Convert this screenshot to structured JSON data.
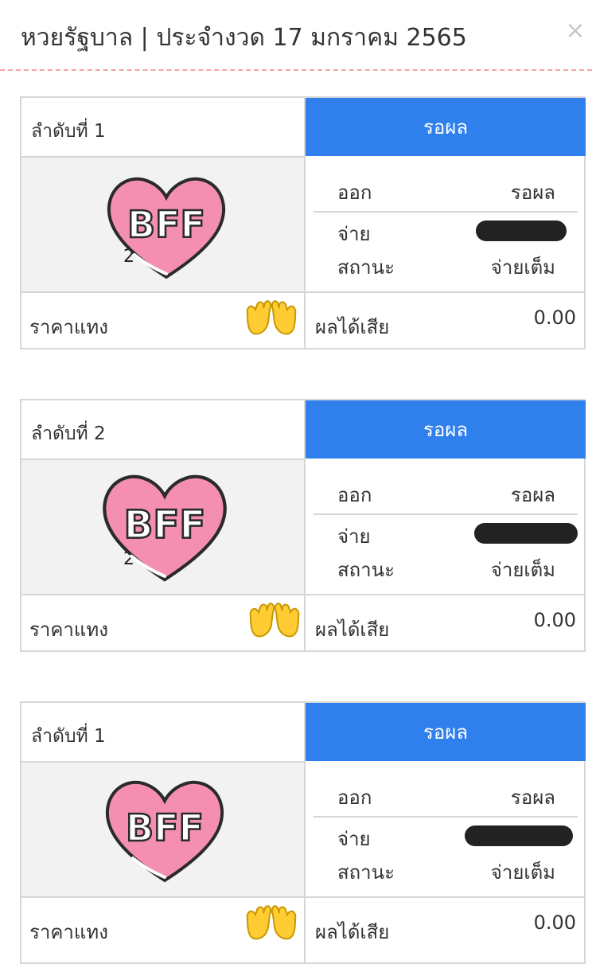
{
  "header": {
    "title": "หวยรัฐบาล | ประจำงวด 17 มกราคม 2565",
    "close_icon": "×"
  },
  "colors": {
    "status_bar": "#2f80ed",
    "divider": "#f4a59b",
    "heart_fill": "#f48fb1",
    "heart_stroke": "#2a2a2a"
  },
  "cards": [
    {
      "seq_label": "ลำดับที่ 1",
      "status": "รอผล",
      "out_label": "ออก",
      "out_value": "รอผล",
      "pay_label": "จ่าย",
      "state_label": "สถานะ",
      "state_value": "จ่ายเต็ม",
      "price_label": "ราคาแทง",
      "pl_label": "ผลได้เสีย",
      "pl_value": "0.00",
      "sticker_text": "BFF",
      "ticket_fragment": "2"
    },
    {
      "seq_label": "ลำดับที่ 2",
      "status": "รอผล",
      "out_label": "ออก",
      "out_value": "รอผล",
      "pay_label": "จ่าย",
      "state_label": "สถานะ",
      "state_value": "จ่ายเต็ม",
      "price_label": "ราคาแทง",
      "pl_label": "ผลได้เสีย",
      "pl_value": "0.00",
      "sticker_text": "BFF",
      "ticket_fragment": "2"
    },
    {
      "seq_label": "ลำดับที่ 1",
      "status": "รอผล",
      "out_label": "ออก",
      "out_value": "รอผล",
      "pay_label": "จ่าย",
      "state_label": "สถานะ",
      "state_value": "จ่ายเต็ม",
      "price_label": "ราคาแทง",
      "pl_label": "ผลได้เสีย",
      "pl_value": "0.00",
      "sticker_text": "BFF",
      "ticket_fragment": ""
    }
  ]
}
